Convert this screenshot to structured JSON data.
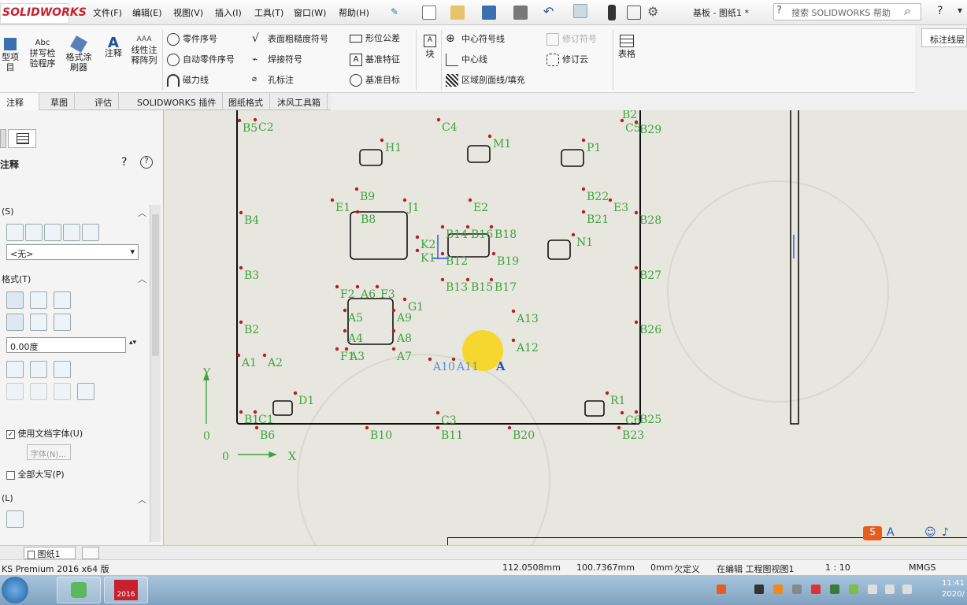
{
  "app": {
    "logo": "SOLIDWORKS",
    "doc_title": "基板 - 图纸1 *",
    "help_search_placeholder": "搜索 SOLIDWORKS 帮助"
  },
  "menu": [
    "文件(F)",
    "编辑(E)",
    "视图(V)",
    "插入(I)",
    "工具(T)",
    "窗口(W)",
    "帮助(H)"
  ],
  "commands": {
    "left_big": [
      {
        "label": "型项\n目"
      },
      {
        "label": "拼写检\n验程序"
      },
      {
        "label": "格式涂\n刷器"
      },
      {
        "label": "注释"
      },
      {
        "label": "线性注\n释阵列"
      }
    ],
    "col1": [
      "零件序号",
      "自动零件序号",
      "磁力线"
    ],
    "col2": [
      "表面粗糙度符号",
      "焊接符号",
      "孔标注"
    ],
    "col3": [
      "形位公差",
      "基准特征",
      "基准目标"
    ],
    "block": "块",
    "col4": [
      "中心符号线",
      "中心线",
      "区域剖面线/填充"
    ],
    "col5": [
      "修订符号",
      "修订云"
    ],
    "table": "表格",
    "right_tab": "标注线层"
  },
  "tabs": [
    "注释",
    "草图",
    "评估",
    "SOLIDWORKS 插件",
    "图纸格式",
    "沐风工具箱"
  ],
  "left_panel": {
    "title": "注释",
    "style_header": "(S)",
    "style_value": "<无>",
    "format_header": "格式(T)",
    "angle": "0.00度",
    "use_doc_font": "使用文档字体(U)",
    "font_button": "字体(N)...",
    "all_caps": "全部大写(P)",
    "leader_header": "(L)"
  },
  "drawing": {
    "labels": [
      "B5",
      "C2",
      "C4",
      "B2",
      "C5",
      "B29",
      "H1",
      "M1",
      "P1",
      "B9",
      "E1",
      "J1",
      "E2",
      "B22",
      "E3",
      "B4",
      "B8",
      "B21",
      "B28",
      "K2",
      "B14",
      "B16",
      "B18",
      "N1",
      "K1",
      "B12",
      "B19",
      "B3",
      "B27",
      "B13",
      "B15",
      "B17",
      "F2",
      "A6",
      "F3",
      "G1",
      "A13",
      "A5",
      "A9",
      "B2",
      "B26",
      "A4",
      "A8",
      "A12",
      "F1",
      "A3",
      "A7",
      "A1",
      "A2",
      "A10",
      "A11",
      "D1",
      "R1",
      "B1",
      "C1",
      "C3",
      "C6",
      "B25",
      "B6",
      "B10",
      "B11",
      "B20",
      "B23"
    ],
    "axis_y": "Y",
    "axis_x": "X",
    "origin1": "0",
    "origin2": "0"
  },
  "sheet_tab": "图纸1",
  "status": {
    "version": "KS Premium 2016 x64 版",
    "x": "112.0508mm",
    "y": "100.7367mm",
    "z": "0mm",
    "defined": "欠定义",
    "editing": "在编辑 工程图视图1",
    "scale": "1 : 10",
    "units": "MMGS"
  },
  "taskbar": {
    "sw_label": "2016",
    "time": "11:41",
    "date": "2020/"
  },
  "colors": {
    "accent": "#c8202e",
    "annotation": "#3fa33f",
    "canvas": "#e7e6df",
    "cursor_highlight": "#f7d51c"
  }
}
